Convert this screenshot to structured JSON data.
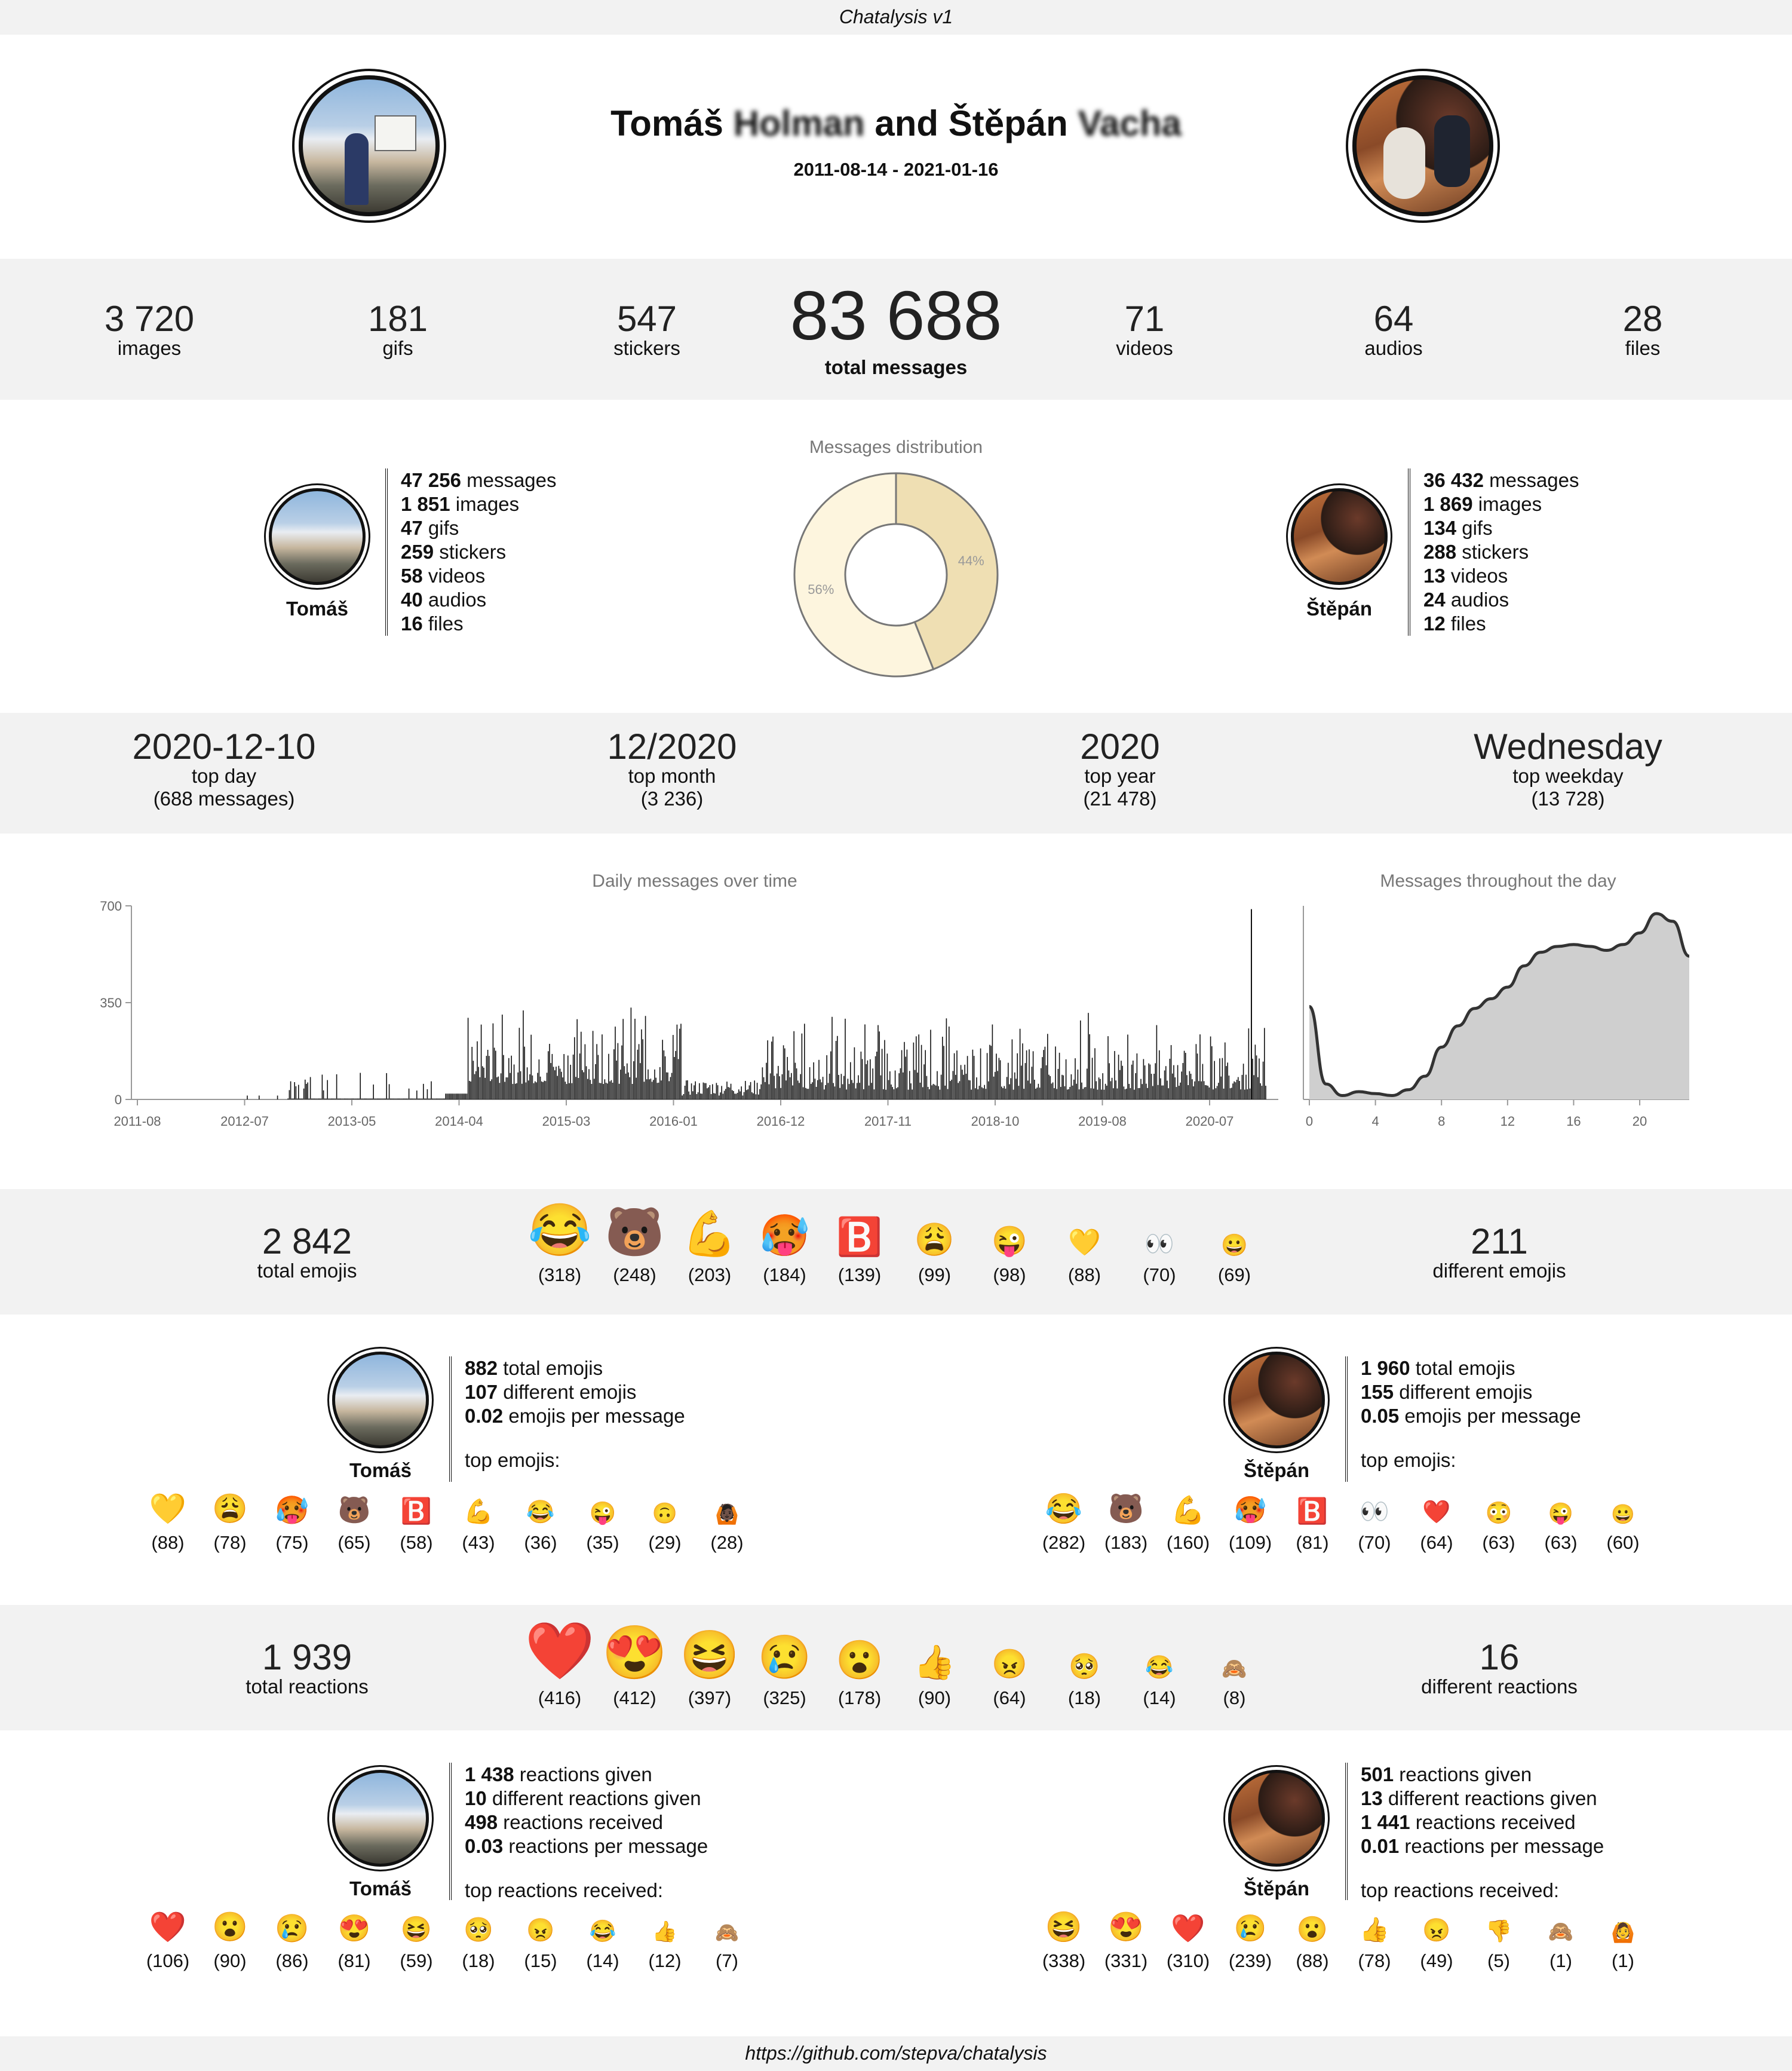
{
  "header": {
    "title": "Chatalysis v1"
  },
  "hero": {
    "name_a": "Tomáš",
    "name_a_surname": "Holman",
    "connector": "and",
    "name_b": "Štěpán",
    "name_b_surname": "Vacha",
    "date_range": "2011-08-14 - 2021-01-16"
  },
  "totals": {
    "images": {
      "value": "3 720",
      "label": "images"
    },
    "gifs": {
      "value": "181",
      "label": "gifs"
    },
    "stickers": {
      "value": "547",
      "label": "stickers"
    },
    "messages": {
      "value": "83 688",
      "label": "total messages"
    },
    "videos": {
      "value": "71",
      "label": "videos"
    },
    "audios": {
      "value": "64",
      "label": "audios"
    },
    "files": {
      "value": "28",
      "label": "files"
    }
  },
  "users": {
    "a": {
      "name": "Tomáš",
      "messages": "47 256",
      "images": "1 851",
      "gifs": "47",
      "stickers": "259",
      "videos": "58",
      "audios": "40",
      "files": "16",
      "emoji_total": "882",
      "emoji_different": "107",
      "emoji_per_msg": "0.02",
      "reactions_given": "1 438",
      "reactions_different": "10",
      "reactions_received": "498",
      "reactions_per_msg": "0.03"
    },
    "b": {
      "name": "Štěpán",
      "messages": "36 432",
      "images": "1 869",
      "gifs": "134",
      "stickers": "288",
      "videos": "13",
      "audios": "24",
      "files": "12",
      "emoji_total": "1 960",
      "emoji_different": "155",
      "emoji_per_msg": "0.05",
      "reactions_given": "501",
      "reactions_different": "13",
      "reactions_received": "1 441",
      "reactions_per_msg": "0.01"
    }
  },
  "words": {
    "messages": "messages",
    "images": "images",
    "gifs": "gifs",
    "stickers": "stickers",
    "videos": "videos",
    "audios": "audios",
    "files": "files",
    "total_emojis": "total emojis",
    "different_emojis": "different emojis",
    "emojis_per_message": "emojis per message",
    "top_emojis": "top emojis:",
    "reactions_given": "reactions given",
    "different_reactions_given": "different reactions given",
    "reactions_received": "reactions received",
    "reactions_per_message": "reactions per message",
    "top_reactions_received": "top reactions received:"
  },
  "distribution": {
    "title": "Messages distribution",
    "chart_data": {
      "type": "pie",
      "labels": [
        "Tomáš",
        "Štěpán"
      ],
      "values": [
        56,
        44
      ],
      "colors": [
        "#fdf5de",
        "#efdfb3"
      ],
      "donut": true
    }
  },
  "tops": {
    "day": {
      "value": "2020-12-10",
      "label": "top day",
      "sub": "(688 messages)"
    },
    "month": {
      "value": "12/2020",
      "label": "top month",
      "sub": "(3 236)"
    },
    "year": {
      "value": "2020",
      "label": "top year",
      "sub": "(21 478)"
    },
    "weekday": {
      "value": "Wednesday",
      "label": "top weekday",
      "sub": "(13 728)"
    }
  },
  "daily_chart": {
    "title": "Daily messages over time",
    "chart_data": {
      "type": "bar",
      "x_ticks": [
        "2011-08",
        "2012-07",
        "2013-05",
        "2014-04",
        "2015-03",
        "2016-01",
        "2016-12",
        "2017-11",
        "2018-10",
        "2019-08",
        "2020-07"
      ],
      "y_ticks": [
        "0",
        "350",
        "700"
      ],
      "ylim": [
        0,
        700
      ],
      "x_range": [
        "2011-08-14",
        "2021-01-16"
      ],
      "peak": {
        "date": "2020-12-10",
        "value": 688
      }
    }
  },
  "hourly_chart": {
    "title": "Messages throughout the day",
    "chart_data": {
      "type": "area",
      "x_ticks": [
        "0",
        "4",
        "8",
        "12",
        "16",
        "20"
      ],
      "x": [
        0,
        1,
        2,
        3,
        4,
        5,
        6,
        7,
        8,
        9,
        10,
        11,
        12,
        13,
        14,
        15,
        16,
        17,
        18,
        19,
        20,
        21,
        22,
        23
      ],
      "values": [
        0.48,
        0.08,
        0.02,
        0.04,
        0.03,
        0.02,
        0.05,
        0.12,
        0.27,
        0.38,
        0.47,
        0.52,
        0.58,
        0.69,
        0.76,
        0.79,
        0.8,
        0.79,
        0.77,
        0.8,
        0.86,
        0.96,
        0.92,
        0.74
      ]
    }
  },
  "emoji_section": {
    "total": {
      "value": "2 842",
      "label": "total emojis"
    },
    "different": {
      "value": "211",
      "label": "different emojis"
    },
    "top": [
      {
        "e": "😂",
        "n": "(318)"
      },
      {
        "e": "🐻",
        "n": "(248)"
      },
      {
        "e": "💪",
        "n": "(203)"
      },
      {
        "e": "🥵",
        "n": "(184)"
      },
      {
        "e": "🅱️",
        "n": "(139)"
      },
      {
        "e": "😩",
        "n": "(99)"
      },
      {
        "e": "😜",
        "n": "(98)"
      },
      {
        "e": "💛",
        "n": "(88)"
      },
      {
        "e": "👀",
        "n": "(70)"
      },
      {
        "e": "😀",
        "n": "(69)"
      }
    ],
    "a_top": [
      {
        "e": "💛",
        "n": "(88)"
      },
      {
        "e": "😩",
        "n": "(78)"
      },
      {
        "e": "🥵",
        "n": "(75)"
      },
      {
        "e": "🐻",
        "n": "(65)"
      },
      {
        "e": "🅱️",
        "n": "(58)"
      },
      {
        "e": "💪",
        "n": "(43)"
      },
      {
        "e": "😂",
        "n": "(36)"
      },
      {
        "e": "😜",
        "n": "(35)"
      },
      {
        "e": "🙃",
        "n": "(29)"
      },
      {
        "e": "🙆🏿",
        "n": "(28)"
      }
    ],
    "b_top": [
      {
        "e": "😂",
        "n": "(282)"
      },
      {
        "e": "🐻",
        "n": "(183)"
      },
      {
        "e": "💪",
        "n": "(160)"
      },
      {
        "e": "🥵",
        "n": "(109)"
      },
      {
        "e": "🅱️",
        "n": "(81)"
      },
      {
        "e": "👀",
        "n": "(70)"
      },
      {
        "e": "❤️",
        "n": "(64)"
      },
      {
        "e": "😳",
        "n": "(63)"
      },
      {
        "e": "😜",
        "n": "(63)"
      },
      {
        "e": "😀",
        "n": "(60)"
      }
    ]
  },
  "reaction_section": {
    "total": {
      "value": "1 939",
      "label": "total reactions"
    },
    "different": {
      "value": "16",
      "label": "different reactions"
    },
    "top": [
      {
        "e": "❤️",
        "n": "(416)"
      },
      {
        "e": "😍",
        "n": "(412)"
      },
      {
        "e": "😆",
        "n": "(397)"
      },
      {
        "e": "😢",
        "n": "(325)"
      },
      {
        "e": "😮",
        "n": "(178)"
      },
      {
        "e": "👍",
        "n": "(90)"
      },
      {
        "e": "😠",
        "n": "(64)"
      },
      {
        "e": "🥺",
        "n": "(18)"
      },
      {
        "e": "😂",
        "n": "(14)"
      },
      {
        "e": "🙈",
        "n": "(8)"
      }
    ],
    "a_top": [
      {
        "e": "❤️",
        "n": "(106)"
      },
      {
        "e": "😮",
        "n": "(90)"
      },
      {
        "e": "😢",
        "n": "(86)"
      },
      {
        "e": "😍",
        "n": "(81)"
      },
      {
        "e": "😆",
        "n": "(59)"
      },
      {
        "e": "🥺",
        "n": "(18)"
      },
      {
        "e": "😠",
        "n": "(15)"
      },
      {
        "e": "😂",
        "n": "(14)"
      },
      {
        "e": "👍",
        "n": "(12)"
      },
      {
        "e": "🙈",
        "n": "(7)"
      }
    ],
    "b_top": [
      {
        "e": "😆",
        "n": "(338)"
      },
      {
        "e": "😍",
        "n": "(331)"
      },
      {
        "e": "❤️",
        "n": "(310)"
      },
      {
        "e": "😢",
        "n": "(239)"
      },
      {
        "e": "😮",
        "n": "(88)"
      },
      {
        "e": "👍",
        "n": "(78)"
      },
      {
        "e": "😠",
        "n": "(49)"
      },
      {
        "e": "👎",
        "n": "(5)"
      },
      {
        "e": "🙈",
        "n": "(1)"
      },
      {
        "e": "🙆",
        "n": "(1)"
      }
    ]
  },
  "footer": {
    "link": "https://github.com/stepva/chatalysis"
  }
}
